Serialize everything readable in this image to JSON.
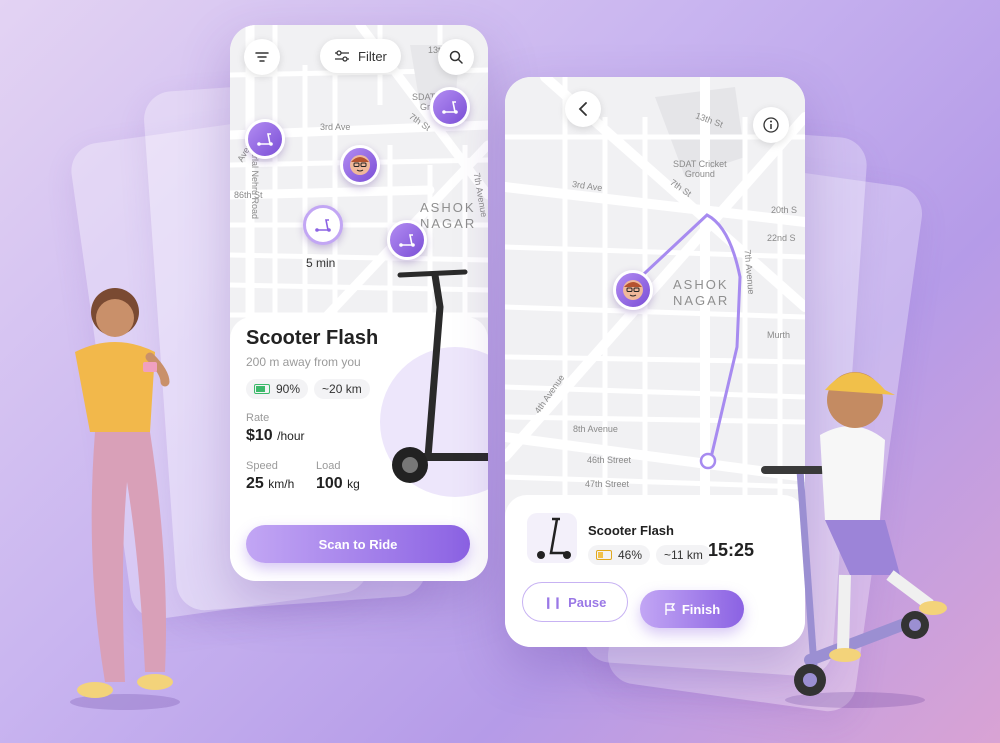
{
  "colors": {
    "accent": "#8b62e3",
    "accent_light": "#c2a6f4",
    "battery_full": "#3cb96a",
    "battery_low": "#f2c14a"
  },
  "left_phone": {
    "filter_label": "Filter",
    "map_labels": {
      "street_13th": "13th",
      "street_7th": "7th St",
      "street_3rd": "3rd Ave",
      "street_86th": "86th St",
      "road_nehru": "Jawaharlal Nehru Road",
      "sdat": "SDAT",
      "gro": "Gro",
      "avenue_left": "Avenue",
      "street_7th_vertical": "7th Avenue"
    },
    "area_label_line1": "ASHOK",
    "area_label_line2": "NAGAR",
    "pin_time": "5 min",
    "title": "Scooter Flash",
    "subtitle": "200 m away from you",
    "battery": "90%",
    "range": "~20 km",
    "rate_label": "Rate",
    "rate_value": "$10",
    "rate_unit": "/hour",
    "speed_label": "Speed",
    "speed_value": "25",
    "speed_unit": "km/h",
    "load_label": "Load",
    "load_value": "100",
    "load_unit": "kg",
    "scan_button": "Scan to Ride"
  },
  "right_phone": {
    "map_labels": {
      "street_13th": "13th St",
      "sdat_line1": "SDAT Cricket",
      "sdat_line2": "Ground",
      "street_7th": "7th St",
      "street_3rd": "3rd Ave",
      "street_20th": "20th S",
      "street_22nd": "22nd S",
      "avenue_4th": "4th Avenue",
      "street_8th": "8th Avenue",
      "street_46th": "46th Street",
      "street_47th": "47th Street",
      "murth": "Murth",
      "avenue_7th": "7th Avenue"
    },
    "area_label_line1": "ASHOK",
    "area_label_line2": "NAGAR",
    "scooter_name": "Scooter Flash",
    "battery": "46%",
    "range": "~11 km",
    "timer": "15:25",
    "pause_button": "Pause",
    "finish_button": "Finish"
  }
}
